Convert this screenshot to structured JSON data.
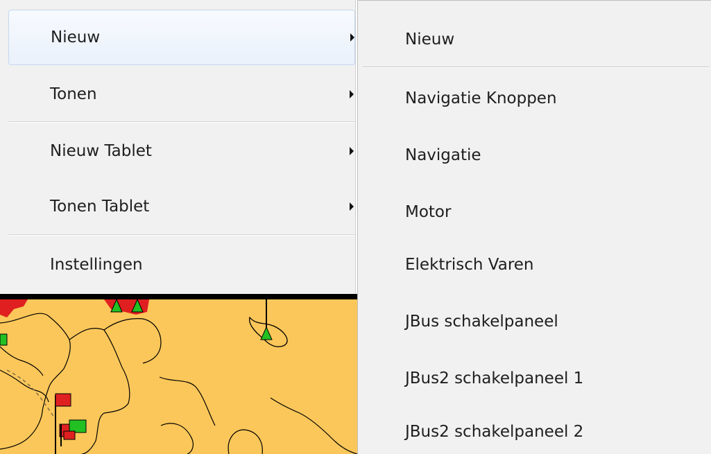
{
  "menu": {
    "items": [
      {
        "label": "Nieuw",
        "has_submenu": true,
        "highlighted": true
      },
      {
        "label": "Tonen",
        "has_submenu": true,
        "highlighted": false
      },
      {
        "label": "Nieuw Tablet",
        "has_submenu": true,
        "highlighted": false
      },
      {
        "label": "Tonen Tablet",
        "has_submenu": true,
        "highlighted": false
      },
      {
        "label": "Instellingen",
        "has_submenu": false,
        "highlighted": false
      }
    ]
  },
  "submenu": {
    "items": [
      {
        "label": "Nieuw"
      },
      {
        "label": "Navigatie Knoppen"
      },
      {
        "label": "Navigatie"
      },
      {
        "label": "Motor"
      },
      {
        "label": "Elektrisch Varen"
      },
      {
        "label": "JBus schakelpaneel"
      },
      {
        "label": "JBus2 schakelpaneel 1"
      },
      {
        "label": "JBus2 schakelpaneel 2"
      }
    ]
  },
  "colors": {
    "menu_background": "#f1f1f1",
    "highlight_border": "#c4d7ee",
    "map_land": "#fbc75a",
    "marker_red": "#e02020",
    "marker_green": "#22c022"
  },
  "icons": {
    "submenu_arrow": "triangle-right"
  }
}
